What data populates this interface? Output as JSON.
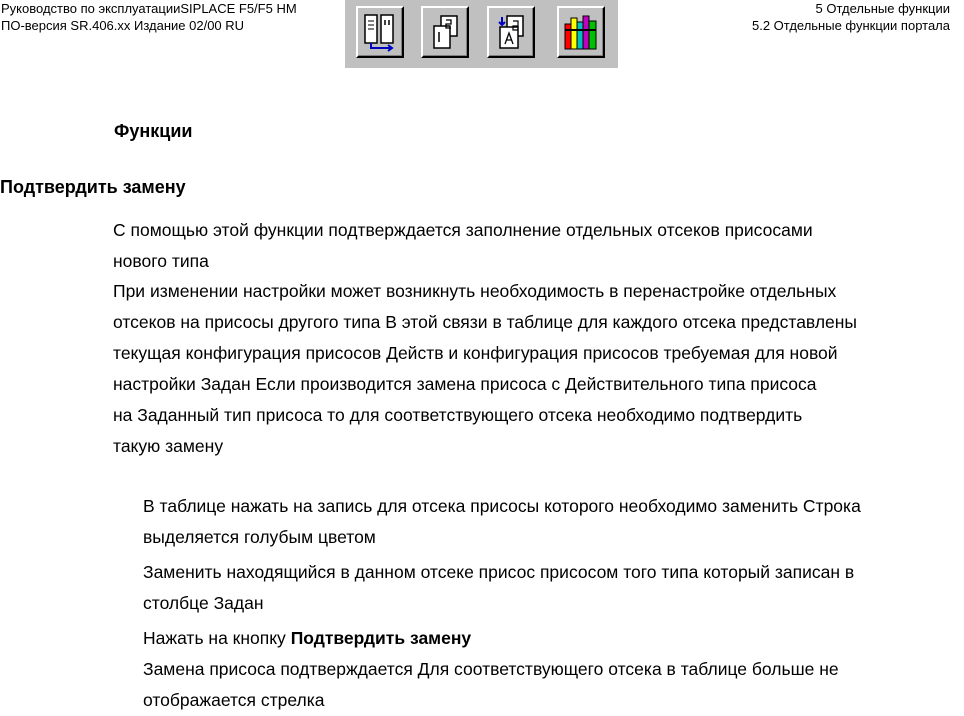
{
  "header": {
    "left_line1": "Руководство по эксплуатацииSIPLACE F5/F5 HM",
    "left_line2": "ПО-версия SR.406.xx   Издание 02/00 RU",
    "right_line1": "5 Отдельные функции",
    "right_line2": "5.2 Отдельные функции портала"
  },
  "toolbar": {
    "buttons": [
      {
        "icon": "document-compare-icon"
      },
      {
        "icon": "copy-pages-icon"
      },
      {
        "icon": "page-arrow-icon"
      },
      {
        "icon": "books-icon"
      }
    ]
  },
  "content": {
    "heading_functions": "Функции",
    "heading_confirm": "Подтвердить замену",
    "para1": [
      "С помощью этой функции подтверждается заполнение отдельных отсеков присосами",
      "нового типа"
    ],
    "para2": [
      "При изменении настройки может возникнуть необходимость в перенастройке отдельных",
      "отсеков на присосы другого типа  В этой связи в таблице для каждого отсека представлены",
      "текущая конфигурация присосов  Действ    и конфигурация присосов  требуемая для новой",
      "настройки  Задан    Если производится замена присоса с  Действительного типа присоса",
      "на  Заданный тип присоса   то для соответствующего отсека необходимо подтвердить",
      "такую замену"
    ],
    "step1": [
      "В таблице нажать на запись для отсека  присосы которого необходимо заменить  Строка",
      "выделяется голубым цветом"
    ],
    "step2": [
      "Заменить находящийся в данном отсеке присос присосом того типа  который записан в",
      "столбце  Задан"
    ],
    "step3_prefix": "Нажать на кнопку ",
    "step3_bold": "Подтвердить замену",
    "step3_result": [
      "Замена присоса подтверждается  Для соответствующего отсека в таблице больше не",
      "отображается стрелка"
    ]
  }
}
